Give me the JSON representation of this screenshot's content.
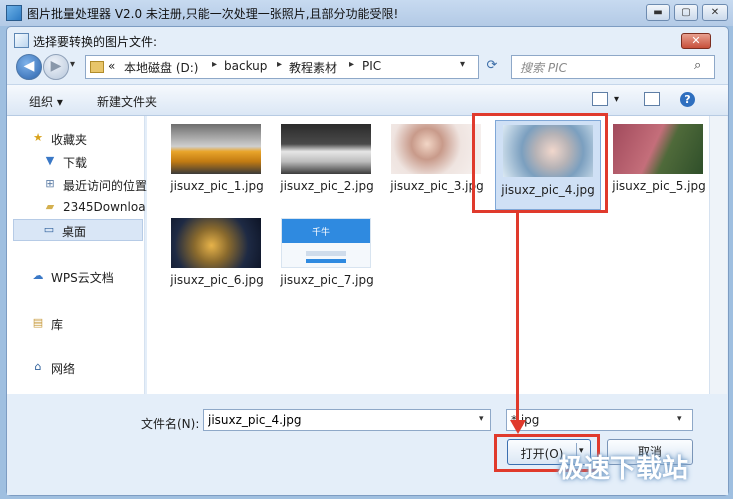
{
  "app": {
    "title": "图片批量处理器 V2.0  未注册,只能一次处理一张照片,且部分功能受限!",
    "minimize_glyph": "▬",
    "maximize_glyph": "▢",
    "close_glyph": "✕"
  },
  "dialog": {
    "title": "选择要转换的图片文件:",
    "close_glyph": "✕"
  },
  "navbar": {
    "back_glyph": "◀",
    "forward_glyph": "▶",
    "recent_glyph": "▾",
    "address": [
      "«",
      "本地磁盘 (D:)",
      "backup",
      "教程素材",
      "PIC"
    ],
    "separator_glyph": "▸",
    "address_dropdown_glyph": "▾",
    "refresh_glyph": "⟳",
    "search_placeholder": "搜索 PIC",
    "search_glyph": "⌕"
  },
  "toolbar": {
    "organize": "组织 ▾",
    "new_folder": "新建文件夹",
    "view_dd": "▾",
    "help": "?"
  },
  "sidebar": {
    "items": [
      {
        "label": "收藏夹",
        "icon": "star-icon",
        "glyph": "★"
      },
      {
        "label": "下载",
        "icon": "download-folder-icon",
        "glyph": "▼"
      },
      {
        "label": "最近访问的位置",
        "icon": "recent-places-icon",
        "glyph": "⊞"
      },
      {
        "label": "2345Downloa",
        "icon": "folder-icon",
        "glyph": "▰"
      },
      {
        "label": "桌面",
        "icon": "desktop-icon",
        "glyph": "▭"
      },
      {
        "label": "WPS云文档",
        "icon": "cloud-icon",
        "glyph": "☁"
      },
      {
        "label": "库",
        "icon": "library-icon",
        "glyph": "▤"
      },
      {
        "label": "网络",
        "icon": "network-icon",
        "glyph": "⌂"
      }
    ]
  },
  "files": [
    {
      "name": "jisuxz_pic_1.jpg",
      "selected": false
    },
    {
      "name": "jisuxz_pic_2.jpg",
      "selected": false
    },
    {
      "name": "jisuxz_pic_3.jpg",
      "selected": false
    },
    {
      "name": "jisuxz_pic_4.jpg",
      "selected": true
    },
    {
      "name": "jisuxz_pic_5.jpg",
      "selected": false
    },
    {
      "name": "jisuxz_pic_6.jpg",
      "selected": false
    },
    {
      "name": "jisuxz_pic_7.jpg",
      "selected": false
    }
  ],
  "footer": {
    "filename_label": "文件名(N):",
    "filename_value": "jisuxz_pic_4.jpg",
    "dropdown_glyph": "▾",
    "filter_value": "*.jpg",
    "open_label": "打开(O)",
    "cancel_label": "取消"
  },
  "thumbnail_text": {
    "qianniu_brand": "千牛"
  },
  "watermark": "极速下载站",
  "colors": {
    "highlight": "#e03a2c",
    "accent": "#3b6fb0"
  }
}
